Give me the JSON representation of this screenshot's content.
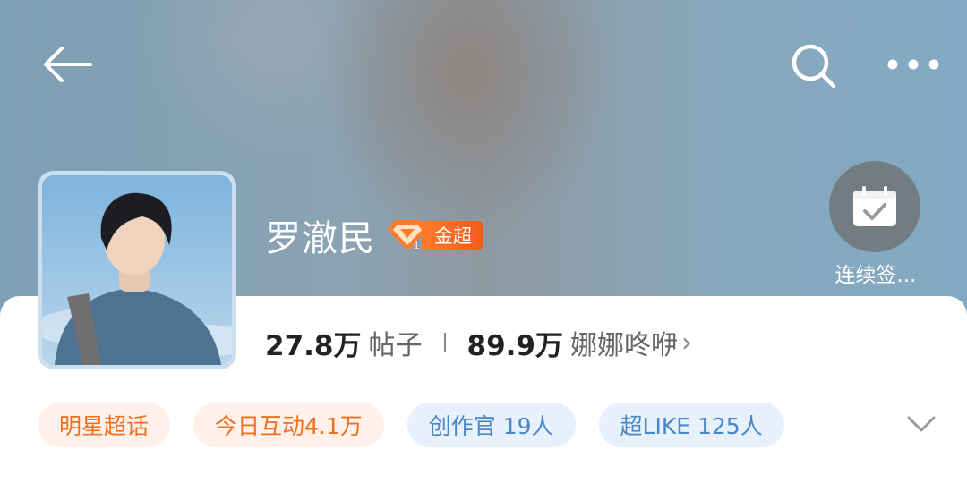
{
  "header": {
    "back_icon": "arrow-left-icon",
    "search_icon": "search-icon",
    "more_icon": "more-horizontal-icon"
  },
  "profile": {
    "title": "罗澈民",
    "badge_text": "金超",
    "badge_icon": "diamond-level-icon",
    "badge_level": "1",
    "avatar": "profile-photo"
  },
  "checkin": {
    "label": "连续签...",
    "icon": "calendar-check-icon"
  },
  "stats": {
    "posts_count": "27.8万",
    "posts_label": "帖子",
    "fans_count": "89.9万",
    "fans_label": "娜娜咚咿",
    "fans_arrow": "›"
  },
  "tags": [
    {
      "label": "明星超话",
      "style": "orange"
    },
    {
      "label": "今日互动4.1万",
      "style": "orange"
    },
    {
      "label": "创作官 19人",
      "style": "blue"
    },
    {
      "label": "超LIKE 125人",
      "style": "blue"
    }
  ],
  "colors": {
    "accent_orange": "#f0701f",
    "accent_blue": "#4a86c8",
    "badge_orange": "#ff7a2a"
  }
}
